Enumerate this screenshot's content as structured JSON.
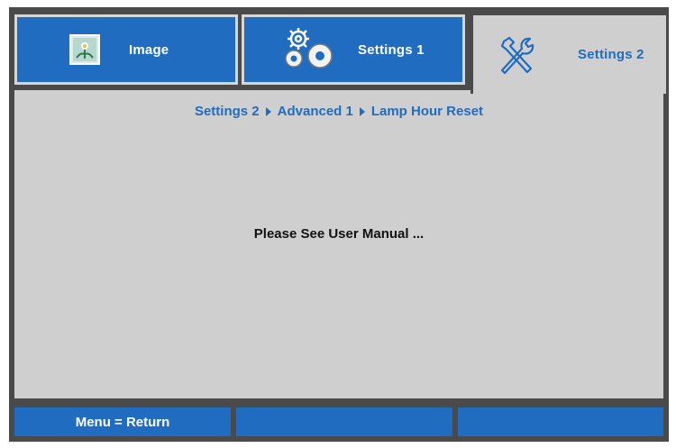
{
  "tabs": [
    {
      "label": "Image",
      "icon": "image-icon"
    },
    {
      "label": "Settings 1",
      "icon": "gears-icon"
    },
    {
      "label": "Settings 2",
      "icon": "tools-icon",
      "active": true
    }
  ],
  "breadcrumb": {
    "items": [
      "Settings 2",
      "Advanced 1",
      "Lamp Hour Reset"
    ]
  },
  "message": "Please See User Manual ...",
  "footer": {
    "hint": "Menu = Return",
    "cell2": "",
    "cell3": ""
  },
  "colors": {
    "accent": "#1f6cc0",
    "panel": "#cfcfcf",
    "frame": "#4a4a4a"
  }
}
